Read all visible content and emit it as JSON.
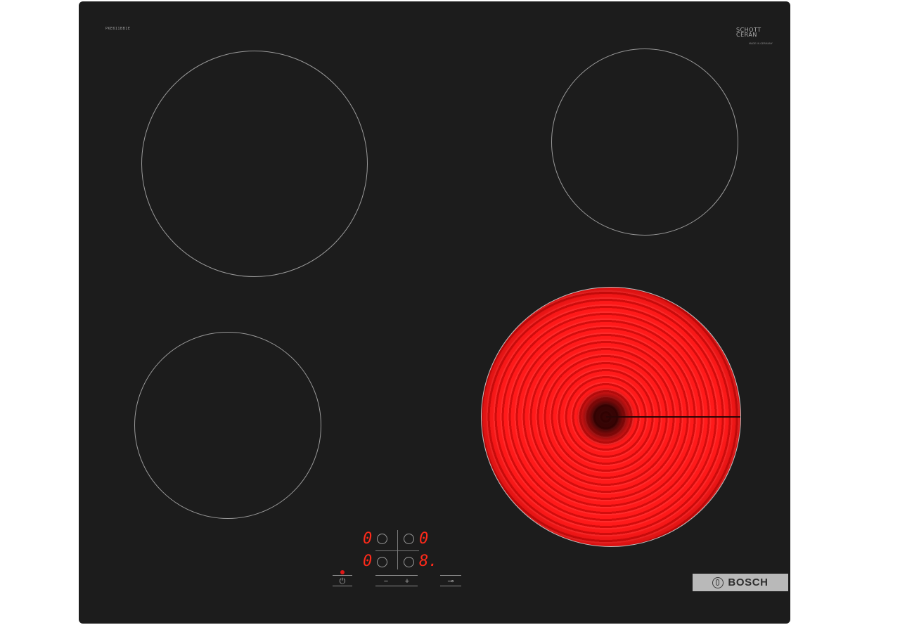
{
  "hob": {
    "model_code": "PKE611BB1E",
    "glass_brand_line1": "SCHOTT",
    "glass_brand_line2": "CERAN",
    "glass_brand_sub": "MADE IN GERMANY",
    "brand": "BOSCH",
    "colors": {
      "glass": "#1c1c1c",
      "zone_outline": "#9a9a9a",
      "heated_zone": "#f01010",
      "display_digits": "#ff2a1a",
      "badge": "#b9b9b9"
    }
  },
  "cooking_zones": [
    {
      "name": "front-left",
      "heating": false
    },
    {
      "name": "rear-left",
      "heating": false
    },
    {
      "name": "rear-right",
      "heating": false
    },
    {
      "name": "front-right",
      "heating": true
    }
  ],
  "control_panel": {
    "display_rear_left": "0",
    "display_rear_right": "0",
    "display_front_left": "0",
    "display_front_right": "8.",
    "power_symbol": "⏻",
    "minus_symbol": "−",
    "plus_symbol": "+",
    "lock_symbol": "⊸"
  }
}
